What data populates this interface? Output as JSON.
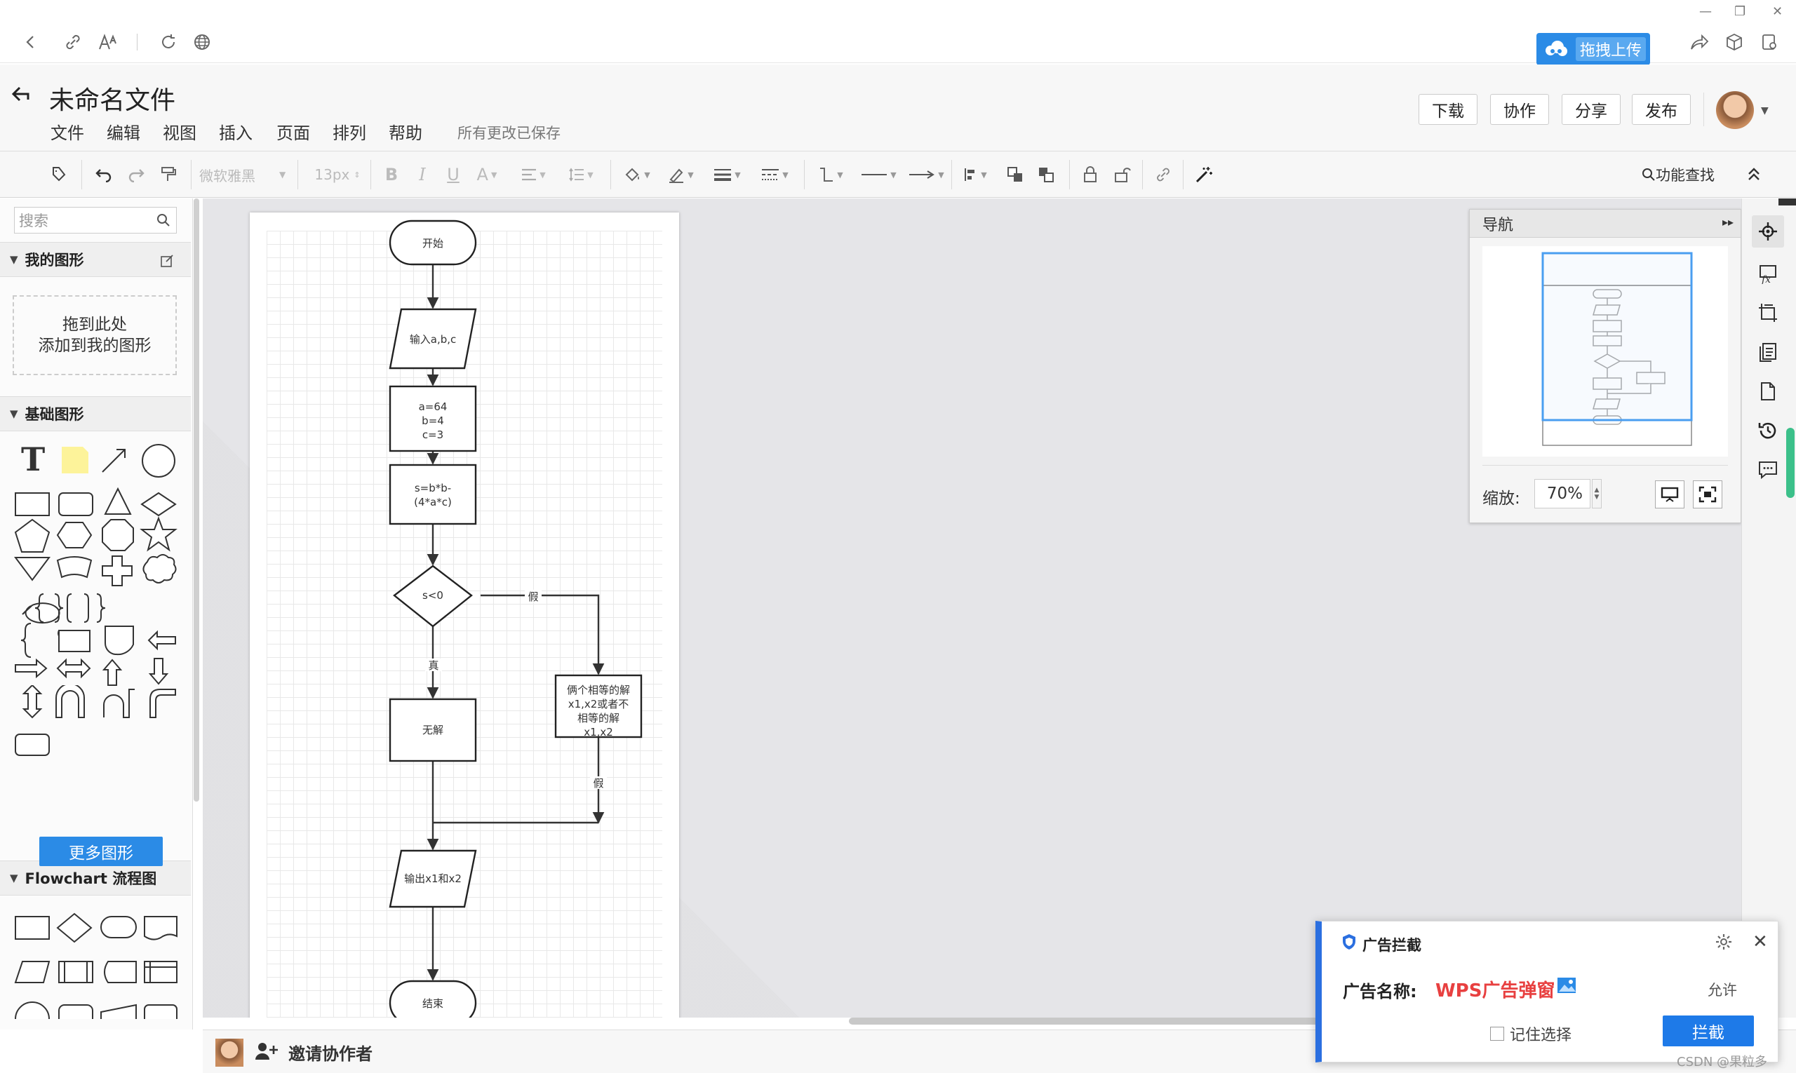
{
  "browser": {
    "upload_label": "拖拽上传"
  },
  "header": {
    "title": "未命名文件",
    "menu": [
      "文件",
      "编辑",
      "视图",
      "插入",
      "页面",
      "排列",
      "帮助"
    ],
    "save_status": "所有更改已保存",
    "buttons": {
      "download": "下载",
      "collab": "协作",
      "share": "分享",
      "publish": "发布"
    }
  },
  "toolbar": {
    "font_family": "微软雅黑",
    "font_size": "13px",
    "feature_search": "功能查找"
  },
  "left_panel": {
    "search_placeholder": "搜索",
    "my_shapes": "我的图形",
    "drop_hint_line1": "拖到此处",
    "drop_hint_line2": "添加到我的图形",
    "basic_shapes": "基础图形",
    "flowchart": "Flowchart 流程图",
    "more_shapes": "更多图形"
  },
  "flowchart": {
    "start": "开始",
    "input": "输入a,b,c",
    "assign": [
      "a=64",
      "b=4",
      "c=3"
    ],
    "calc": [
      "s=b*b-",
      "(4*a*c)"
    ],
    "decision": "s<0",
    "false_label": "假",
    "true_label": "真",
    "no_solution": "无解",
    "solutions": [
      "俩个相等的解",
      "x1,x2或者不",
      "相等的解",
      "x1,x2"
    ],
    "false_label2": "假",
    "output": "输出x1和x2",
    "end": "结束"
  },
  "navigator": {
    "title": "导航",
    "zoom_label": "缩放:",
    "zoom_value": "70%"
  },
  "bottom": {
    "invite": "邀请协作者"
  },
  "ad_popup": {
    "title": "广告拦截",
    "name_label": "广告名称:",
    "name_value": "WPS广告弹窗",
    "allow": "允许",
    "remember": "记住选择",
    "block": "拦截"
  },
  "watermark": "CSDN @果粒多"
}
